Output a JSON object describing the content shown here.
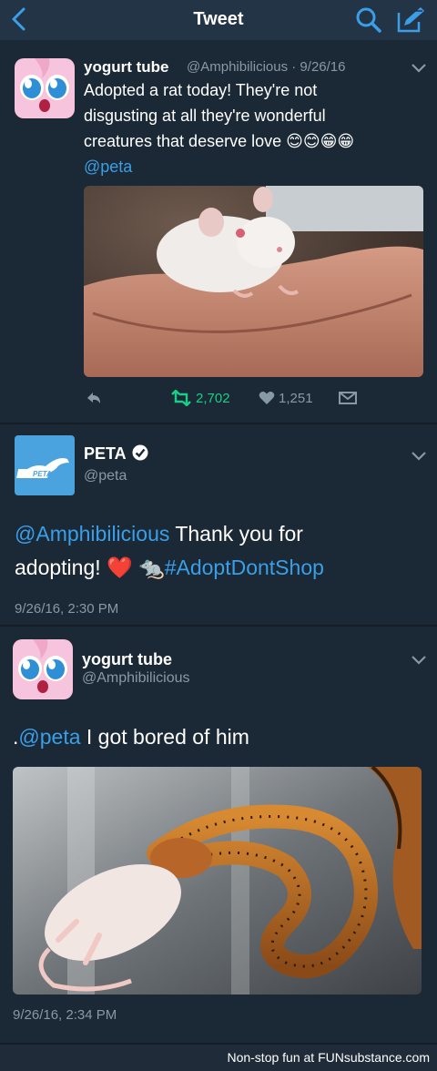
{
  "header": {
    "title": "Tweet"
  },
  "tweet1": {
    "name": "yogurt tube",
    "handle_date": "@Amphibilicious · 9/26/16",
    "text_lines": [
      "Adopted a rat today! They're not",
      "disgusting at all they're wonderful",
      "creatures that deserve love 😊😊😁😁"
    ],
    "mention": "@peta",
    "retweets": "2,702",
    "likes": "1,251"
  },
  "tweet2": {
    "name": "PETA",
    "handle": "@peta",
    "mention": "@Amphibilicious",
    "text_a": " Thank you for",
    "text_b": "adopting! ❤️ 🐀",
    "hashtag": "#AdoptDontShop",
    "timestamp": "9/26/16, 2:30 PM",
    "logo_text": "PETA"
  },
  "tweet3": {
    "name": "yogurt tube",
    "handle": "@Amphibilicious",
    "prefix": ".",
    "mention": "@peta",
    "text": " I got bored of him",
    "timestamp": "9/26/16, 2:34 PM"
  },
  "footer": {
    "text": "Non-stop fun at FUNsubstance.com"
  },
  "colors": {
    "background": "#141d26",
    "card": "#1b2836",
    "topbar": "#243447",
    "link": "#3a9fe6",
    "muted": "#8899a6",
    "retweet_green": "#19cf86",
    "heart": "#e0245e"
  }
}
